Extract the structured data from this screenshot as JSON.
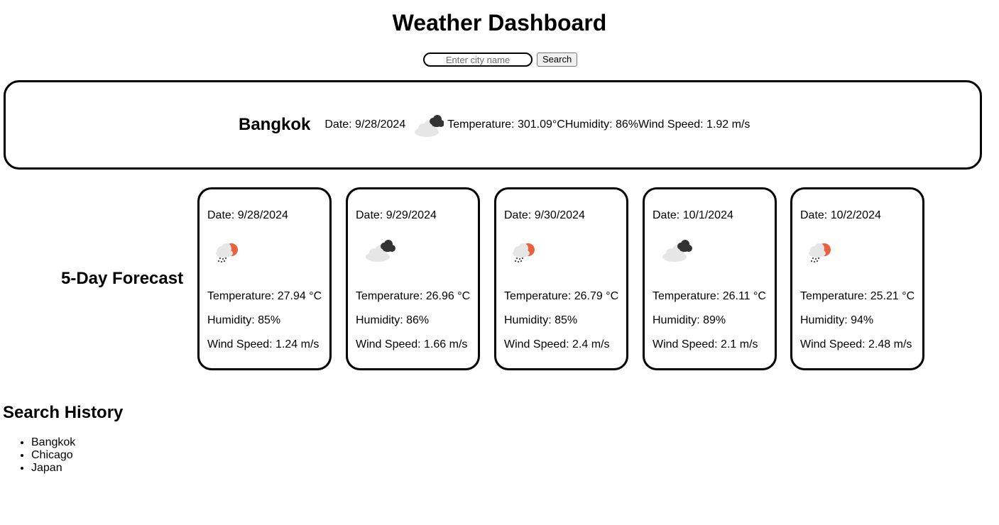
{
  "title": "Weather Dashboard",
  "search": {
    "placeholder": "Enter city name",
    "value": "",
    "button_label": "Search"
  },
  "current": {
    "city": "Bangkok",
    "date": "Date: 9/28/2024",
    "icon": "dark-clouds-icon",
    "temperature": "Temperature: 301.09°C",
    "humidity": "Humidity: 86%",
    "wind": "Wind Speed: 1.92 m/s"
  },
  "forecast_heading": "5-Day Forecast",
  "forecast": [
    {
      "date": "Date: 9/28/2024",
      "icon": "sun-rain-icon",
      "temperature": "Temperature: 27.94 °C",
      "humidity": "Humidity: 85%",
      "wind": "Wind Speed: 1.24 m/s"
    },
    {
      "date": "Date: 9/29/2024",
      "icon": "dark-clouds-icon",
      "temperature": "Temperature: 26.96 °C",
      "humidity": "Humidity: 86%",
      "wind": "Wind Speed: 1.66 m/s"
    },
    {
      "date": "Date: 9/30/2024",
      "icon": "sun-rain-icon",
      "temperature": "Temperature: 26.79 °C",
      "humidity": "Humidity: 85%",
      "wind": "Wind Speed: 2.4 m/s"
    },
    {
      "date": "Date: 10/1/2024",
      "icon": "dark-clouds-icon",
      "temperature": "Temperature: 26.11 °C",
      "humidity": "Humidity: 89%",
      "wind": "Wind Speed: 2.1 m/s"
    },
    {
      "date": "Date: 10/2/2024",
      "icon": "sun-rain-icon",
      "temperature": "Temperature: 25.21 °C",
      "humidity": "Humidity: 94%",
      "wind": "Wind Speed: 2.48 m/s"
    }
  ],
  "history": {
    "heading": "Search History",
    "items": [
      "Bangkok",
      "Chicago",
      "Japan"
    ]
  },
  "colors": {
    "sun": "#e8623f",
    "cloud_light": "#e6e6e6",
    "cloud_dark": "#333333",
    "rain": "#555555"
  }
}
